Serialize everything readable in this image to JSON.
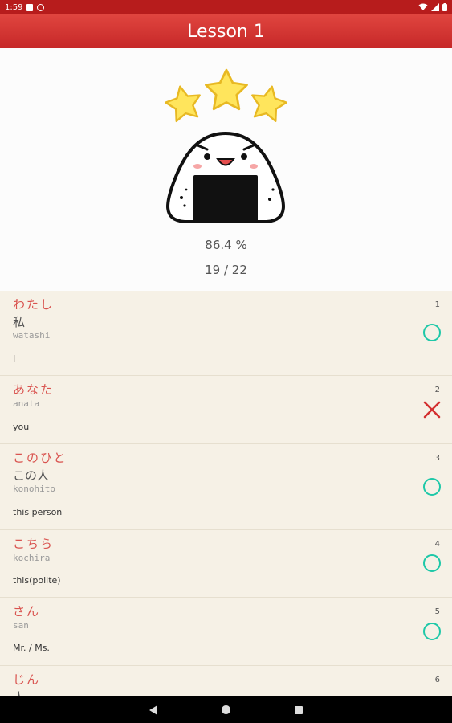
{
  "status_bar": {
    "time": "1:59"
  },
  "header": {
    "title": "Lesson 1"
  },
  "result": {
    "stars": 3,
    "percent": "86.4 %",
    "score": "19 / 22"
  },
  "items": [
    {
      "kana": "わたし",
      "kanji": "私",
      "romaji": "watashi",
      "meaning": "I",
      "number": "1",
      "result": "correct"
    },
    {
      "kana": "あなた",
      "kanji": "",
      "romaji": "anata",
      "meaning": "you",
      "number": "2",
      "result": "wrong"
    },
    {
      "kana": "このひと",
      "kanji": "この人",
      "romaji": "konohito",
      "meaning": "this person",
      "number": "3",
      "result": "correct"
    },
    {
      "kana": "こちら",
      "kanji": "",
      "romaji": "kochira",
      "meaning": "this(polite)",
      "number": "4",
      "result": "correct"
    },
    {
      "kana": "さん",
      "kanji": "",
      "romaji": "san",
      "meaning": "Mr. / Ms.",
      "number": "5",
      "result": "correct"
    },
    {
      "kana": "じん",
      "kanji": "人",
      "romaji": "",
      "meaning": "",
      "number": "6",
      "result": ""
    }
  ],
  "colors": {
    "app_bar": "#d32f2f",
    "status_bar": "#b71c1c",
    "kana": "#d9534f",
    "correct": "#1ec8a8",
    "wrong": "#d32f2f",
    "list_bg": "#f6f1e6"
  }
}
